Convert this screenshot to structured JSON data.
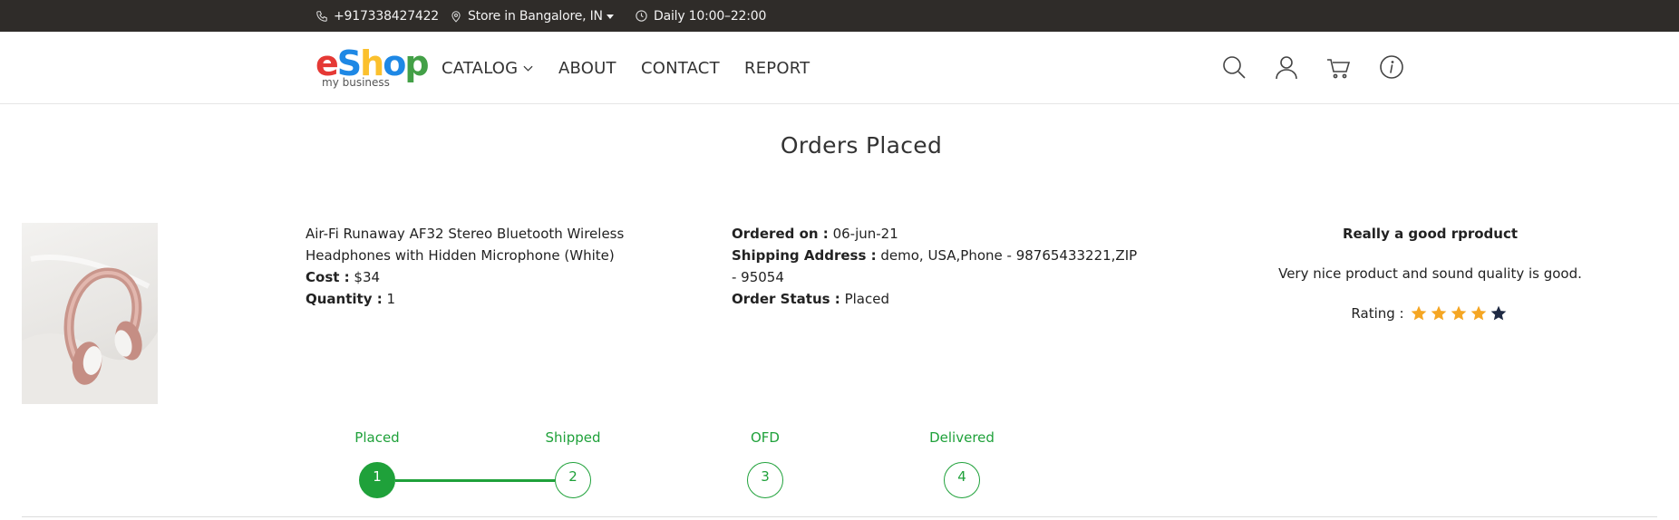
{
  "topbar": {
    "phone": "+917338427422",
    "store": "Store in Bangalore, IN",
    "hours": "Daily 10:00–22:00"
  },
  "logo": {
    "letters": [
      {
        "char": "e",
        "color": "#e53935"
      },
      {
        "char": "S",
        "color": "#1e88e5"
      },
      {
        "char": "h",
        "color": "#fbc02d"
      },
      {
        "char": "o",
        "color": "#1e88e5"
      },
      {
        "char": "p",
        "color": "#43a047"
      }
    ],
    "subtitle": "my business"
  },
  "nav": {
    "catalog": "CATALOG",
    "about": "ABOUT",
    "contact": "CONTACT",
    "report": "REPORT"
  },
  "header_icons": [
    "search-icon",
    "user-icon",
    "cart-icon",
    "info-icon"
  ],
  "page": {
    "title": "Orders Placed"
  },
  "order": {
    "product_name": "Air-Fi Runaway AF32 Stereo Bluetooth Wireless Headphones with Hidden Microphone (White)",
    "cost_label": "Cost :",
    "cost_value": "$34",
    "quantity_label": "Quantity :",
    "quantity_value": "1",
    "ordered_on_label": "Ordered on :",
    "ordered_on_value": "06-jun-21",
    "shipping_label": "Shipping Address :",
    "shipping_value": "demo, USA,Phone - 98765433221,ZIP - 95054",
    "status_label": "Order Status :",
    "status_value": "Placed"
  },
  "review": {
    "title": "Really a good rproduct",
    "text": "Very nice product and sound quality is good.",
    "rating_label": "Rating :",
    "rating_value": 4,
    "rating_max": 5
  },
  "tracker": {
    "steps": [
      {
        "label": "Placed",
        "number": "1",
        "active": true
      },
      {
        "label": "Shipped",
        "number": "2",
        "active": false
      },
      {
        "label": "OFD",
        "number": "3",
        "active": false
      },
      {
        "label": "Delivered",
        "number": "4",
        "active": false
      }
    ]
  },
  "colors": {
    "topbar_bg": "#2f2c29",
    "accent_green": "#1fa13a",
    "star_filled": "#f5a623",
    "star_empty": "#1f2a44"
  }
}
